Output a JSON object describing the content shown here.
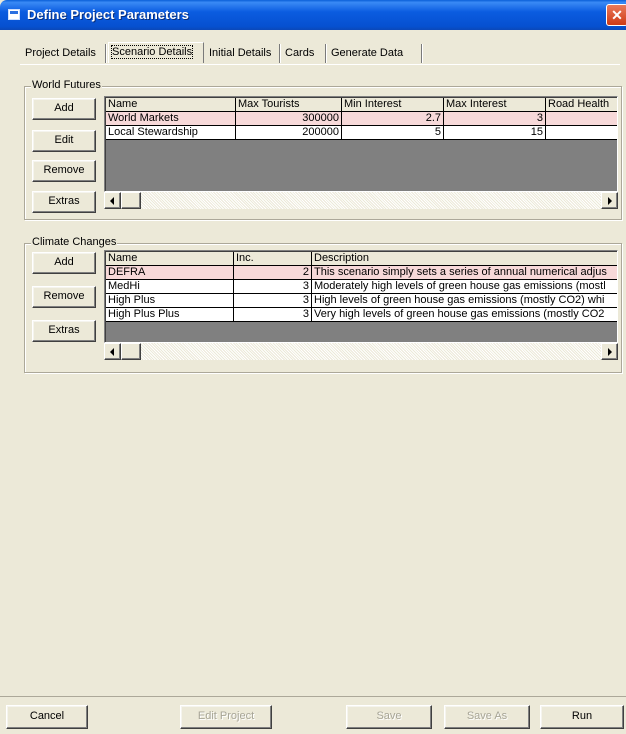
{
  "window": {
    "title": "Define Project Parameters",
    "close_glyph": "✕"
  },
  "tabs": [
    {
      "label": "Project Details"
    },
    {
      "label": "Scenario Details"
    },
    {
      "label": "Initial Details"
    },
    {
      "label": "Cards"
    },
    {
      "label": "Generate Data"
    }
  ],
  "active_tab": "Scenario Details",
  "world_futures": {
    "title": "World Futures",
    "buttons": {
      "add": "Add",
      "edit": "Edit",
      "remove": "Remove",
      "extras": "Extras"
    },
    "columns": [
      "Name",
      "Max Tourists",
      "Min Interest",
      "Max Interest",
      "Road Health"
    ],
    "rows": [
      {
        "name": "World Markets",
        "max_tourists": "300000",
        "min_interest": "2.7",
        "max_interest": "3",
        "road_health": ""
      },
      {
        "name": "Local Stewardship",
        "max_tourists": "200000",
        "min_interest": "5",
        "max_interest": "15",
        "road_health": ""
      }
    ]
  },
  "climate_changes": {
    "title": "Climate Changes",
    "buttons": {
      "add": "Add",
      "remove": "Remove",
      "extras": "Extras"
    },
    "columns": [
      "Name",
      "Inc.",
      "Description"
    ],
    "rows": [
      {
        "name": "DEFRA",
        "inc": "2",
        "description": "This scenario simply sets a series of annual numerical adjus"
      },
      {
        "name": "MedHi",
        "inc": "3",
        "description": "Moderately high levels of green house gas emissions (mostl"
      },
      {
        "name": "High Plus",
        "inc": "3",
        "description": "High levels of green house gas emissions (mostly CO2) whi"
      },
      {
        "name": "High Plus Plus",
        "inc": "3",
        "description": "Very high levels of green house gas emissions (mostly CO2"
      }
    ]
  },
  "footer": {
    "cancel": "Cancel",
    "edit_project": "Edit Project",
    "save": "Save",
    "save_as": "Save As",
    "run": "Run"
  },
  "colors": {
    "selected_row": "#f7d9d9",
    "titlebar": "#0b5ce0",
    "face": "#ece9d8"
  }
}
